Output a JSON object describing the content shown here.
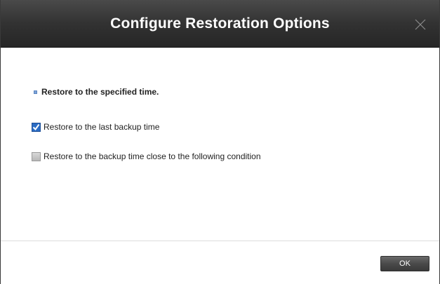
{
  "dialog": {
    "title": "Configure Restoration Options"
  },
  "section": {
    "heading": "Restore to the specified time."
  },
  "options": [
    {
      "label": "Restore to the last backup time",
      "checked": true
    },
    {
      "label": "Restore to the backup time close to the following condition",
      "checked": false
    }
  ],
  "footer": {
    "ok_label": "OK"
  },
  "icons": {
    "close": "close-icon",
    "bullet": "bullet-icon",
    "checkmark": "checkmark-icon"
  },
  "colors": {
    "titlebar": "#333333",
    "checkbox_checked": "#2b6cc4",
    "bullet": "#7ea4d8"
  }
}
